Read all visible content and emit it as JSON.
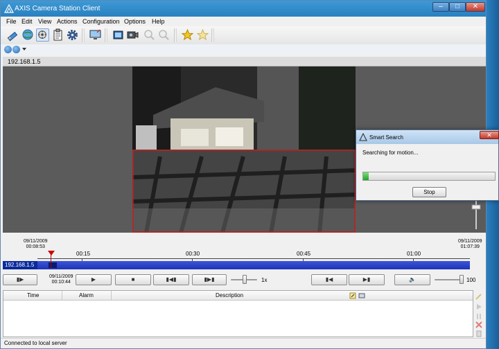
{
  "window": {
    "title": "AXIS Camera Station Client"
  },
  "window_controls": {
    "minimize": "–",
    "maximize": "□",
    "close": "✕"
  },
  "menu": [
    "File",
    "Edit",
    "View",
    "Actions",
    "Configuration",
    "Options",
    "Help"
  ],
  "toolbar_icons": [
    "pencil-icon",
    "globe-icon",
    "recordings-icon",
    "clipboard-icon",
    "gear-icon",
    "monitor-icon",
    "film-icon",
    "camera-icon",
    "zoom-in-icon",
    "zoom-out-icon",
    "star-icon",
    "star-add-icon"
  ],
  "camera": {
    "name": "192.168.1.5"
  },
  "timeline": {
    "start_date": "09/11/2009",
    "start_time": "00:08:53",
    "end_date": "09/11/2009",
    "end_time": "01:07:39",
    "ticks": [
      "00:15",
      "00:30",
      "00:45",
      "01:00"
    ],
    "track_label": "192.168.1.5"
  },
  "playback": {
    "current_date": "09/11/2009",
    "current_time": "00:10:44",
    "speed": "1x",
    "volume": "100"
  },
  "events": {
    "columns": [
      "Time",
      "Alarm",
      "Description"
    ]
  },
  "status": {
    "text": "Connected to local server"
  },
  "dialog": {
    "title": "Smart Search",
    "message": "Searching for motion...",
    "progress_percent": 4,
    "stop_label": "Stop",
    "close_glyph": "✕"
  },
  "colors": {
    "accent": "#2a7fbf",
    "timeline": "#2a44c8",
    "marker": "#c00000",
    "progress": "#21a42a",
    "roi": "#c81c1c"
  }
}
